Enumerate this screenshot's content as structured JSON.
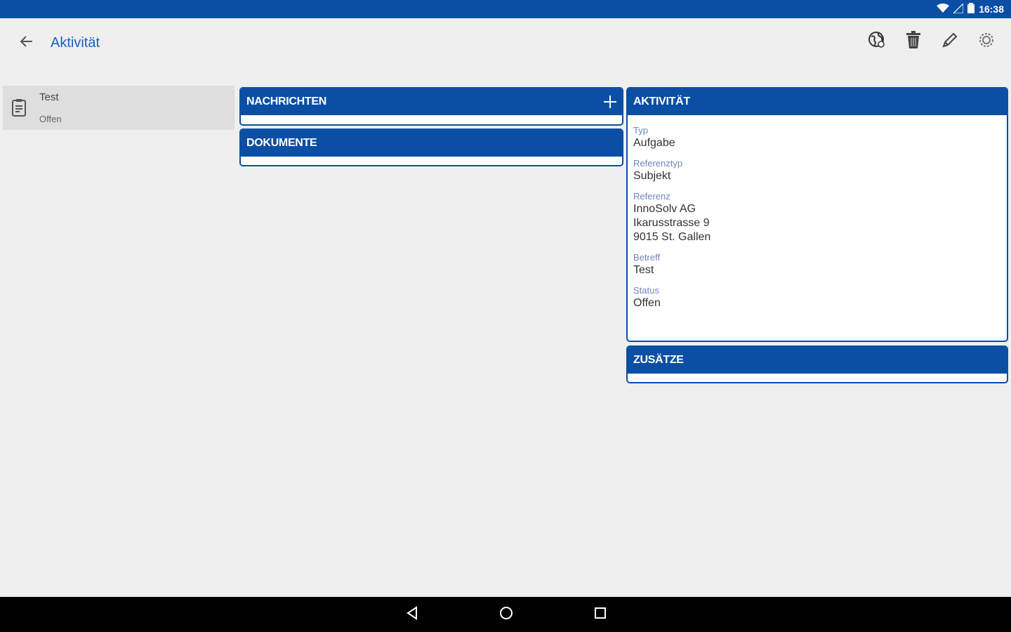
{
  "status_bar": {
    "time": "16:38"
  },
  "app_bar": {
    "title": "Aktivität",
    "actions": [
      "globe-icon",
      "trash-icon",
      "pencil-icon",
      "settings-icon"
    ]
  },
  "list": {
    "items": [
      {
        "title": "Test",
        "subtitle": "Offen",
        "icon": "clipboard-icon"
      }
    ]
  },
  "middle": {
    "messages_title": "NACHRICHTEN",
    "documents_title": "DOKUMENTE"
  },
  "activity": {
    "title": "AKTIVITÄT",
    "fields": [
      {
        "label": "Typ",
        "value": "Aufgabe"
      },
      {
        "label": "Referenztyp",
        "value": "Subjekt"
      },
      {
        "label": "Referenz",
        "lines": [
          "InnoSolv AG",
          "Ikarusstrasse 9",
          "9015 St. Gallen"
        ]
      },
      {
        "label": "Betreff",
        "value": "Test"
      },
      {
        "label": "Status",
        "value": "Offen"
      }
    ]
  },
  "extras": {
    "title": "ZUSÄTZE"
  },
  "colors": {
    "primary": "#0a4fa3",
    "title_blue": "#1a5fbf",
    "label_blue": "#6f86c0",
    "background": "#efefef"
  }
}
